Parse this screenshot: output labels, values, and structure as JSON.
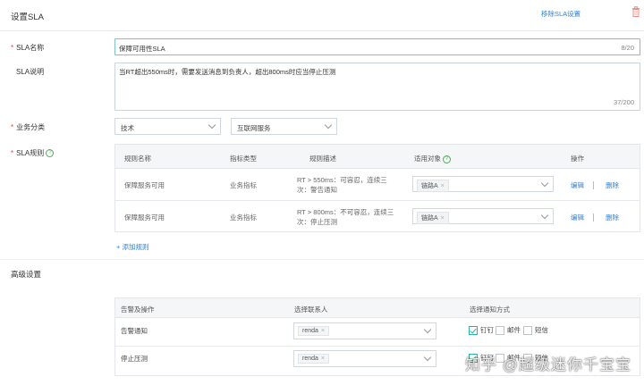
{
  "header": {
    "title": "设置SLA",
    "remove_link": "移除SLA设置",
    "delete_icon": "trash-icon"
  },
  "form": {
    "name_label": "SLA名称",
    "name_value": "保障可用性SLA",
    "name_count": "8/20",
    "desc_label": "SLA说明",
    "desc_value": "当RT超出550ms时，需要发送消息到负责人，超出800ms时应当停止压测",
    "desc_count": "37/200",
    "category_label": "业务分类",
    "category_1": "技术",
    "category_2": "互联网服务",
    "rules_label": "SLA规则"
  },
  "rules_table": {
    "headers": {
      "name": "规则名称",
      "metric": "指标类型",
      "desc": "规则描述",
      "target": "适用对象",
      "ops": "操作"
    },
    "rows": [
      {
        "name": "保障服务可用",
        "metric": "业务指标",
        "desc_line1": "RT > 550ms：可容忍，连续三",
        "desc_line2": "次：警告通知",
        "target": "链路A",
        "edit": "编辑",
        "delete": "删除"
      },
      {
        "name": "保障服务可用",
        "metric": "业务指标",
        "desc_line1": "RT > 800ms：不可容忍，连续三",
        "desc_line2": "次：停止压测",
        "target": "链路A",
        "edit": "编辑",
        "delete": "删除"
      }
    ],
    "add_rule": "+ 添加规则"
  },
  "advanced": {
    "title": "高级设置",
    "headers": {
      "action": "告警及操作",
      "contact": "选择联系人",
      "notify": "选择通知方式"
    },
    "rows": [
      {
        "action": "告警通知",
        "contact": "renda",
        "opt1": "钉钉",
        "opt1_checked": true,
        "opt2": "邮件",
        "opt2_checked": false,
        "opt3": "短信",
        "opt3_checked": false
      },
      {
        "action": "停止压测",
        "contact": "renda",
        "opt1": "钉钉",
        "opt1_checked": true,
        "opt2": "邮件",
        "opt2_checked": false,
        "opt3": "短信",
        "opt3_checked": false
      }
    ]
  },
  "watermark": "知乎 @超级迷你千宝宝"
}
